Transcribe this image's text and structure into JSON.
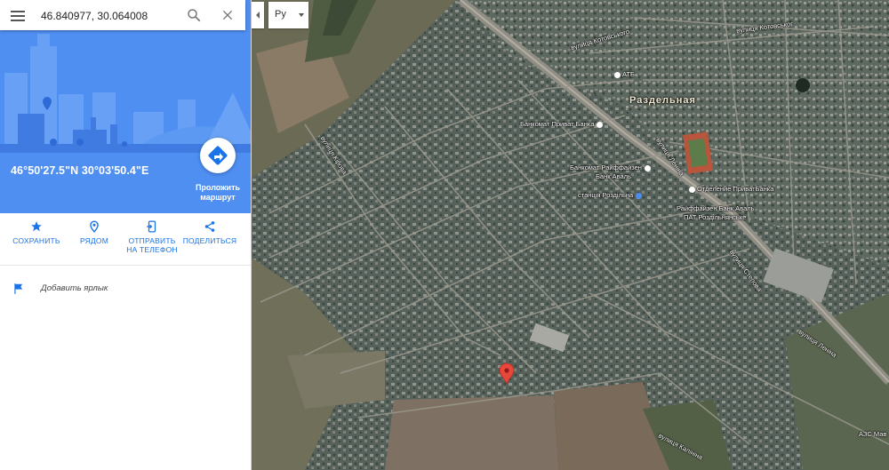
{
  "search": {
    "value": "46.840977, 30.064008"
  },
  "place": {
    "coords_dms": "46°50'27.5\"N 30°03'50.4\"E",
    "route_label_line1": "Проложить",
    "route_label_line2": "маршрут"
  },
  "actions": [
    {
      "label_line1": "СОХРАНИТЬ",
      "label_line2": "",
      "icon": "star-icon"
    },
    {
      "label_line1": "РЯДОМ",
      "label_line2": "",
      "icon": "nearby-icon"
    },
    {
      "label_line1": "ОТПРАВИТЬ",
      "label_line2": "НА ТЕЛЕФОН",
      "icon": "send-to-phone-icon"
    },
    {
      "label_line1": "ПОДЕЛИТЬСЯ",
      "label_line2": "",
      "icon": "share-icon"
    }
  ],
  "add_label": "Добавить ярлык",
  "language": {
    "selected": "Ру"
  },
  "map": {
    "town": "Раздельная",
    "streets": [
      {
        "text": "вулиця Котовського"
      },
      {
        "text": "вулиця Котовськог"
      },
      {
        "text": "вулиця Кірова"
      },
      {
        "text": "вулиця Леніна"
      },
      {
        "text": "вулиця Степова"
      },
      {
        "text": "вулиця Леніна"
      },
      {
        "text": "вулиця Калініна"
      }
    ],
    "pois": [
      {
        "text": "АТБ"
      },
      {
        "text": "Банкомат Приват Банка"
      },
      {
        "text": "Банкомат Райффайзен"
      },
      {
        "text": "Банк Аваль"
      },
      {
        "text": "станція Роздільна"
      },
      {
        "text": "Отделение ПриватБанка"
      },
      {
        "text": "Райффайзен Банк Аваль"
      },
      {
        "text": "ПАТ Роздільнянське"
      },
      {
        "text": "АЗС Мав"
      }
    ]
  },
  "colors": {
    "accent": "#1a73e8",
    "hero": "#4f8ff2",
    "pin": "#e8473b"
  }
}
